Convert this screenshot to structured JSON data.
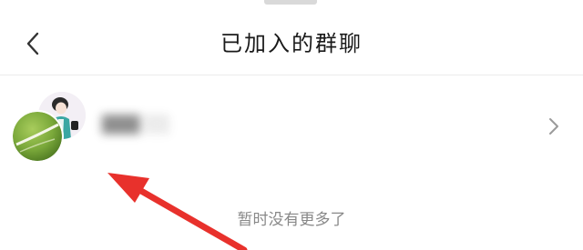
{
  "header": {
    "title": "已加入的群聊",
    "back_icon": "chevron-left-icon"
  },
  "group": {
    "name": "███ ░░",
    "chevron_icon": "chevron-right-icon"
  },
  "footer": {
    "no_more_text": "暂时没有更多了"
  },
  "colors": {
    "annotation_arrow": "#e8312c",
    "divider": "#ececec",
    "hint_text": "#888888"
  }
}
